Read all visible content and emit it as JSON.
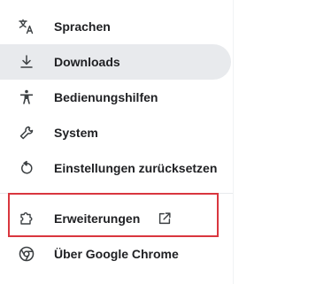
{
  "menu": {
    "items": [
      {
        "label": "Sprachen",
        "icon": "translate-icon"
      },
      {
        "label": "Downloads",
        "icon": "download-icon",
        "selected": true
      },
      {
        "label": "Bedienungshilfen",
        "icon": "accessibility-icon"
      },
      {
        "label": "System",
        "icon": "wrench-icon"
      },
      {
        "label": "Einstellungen zurücksetzen",
        "icon": "reset-icon"
      },
      {
        "label": "Erweiterungen",
        "icon": "extension-puzzle-icon",
        "external": true,
        "highlighted": true
      },
      {
        "label": "Über Google Chrome",
        "icon": "chrome-logo-icon"
      }
    ]
  },
  "colors": {
    "selected_bg": "#e8eaed",
    "highlight_border": "#d9363e"
  }
}
